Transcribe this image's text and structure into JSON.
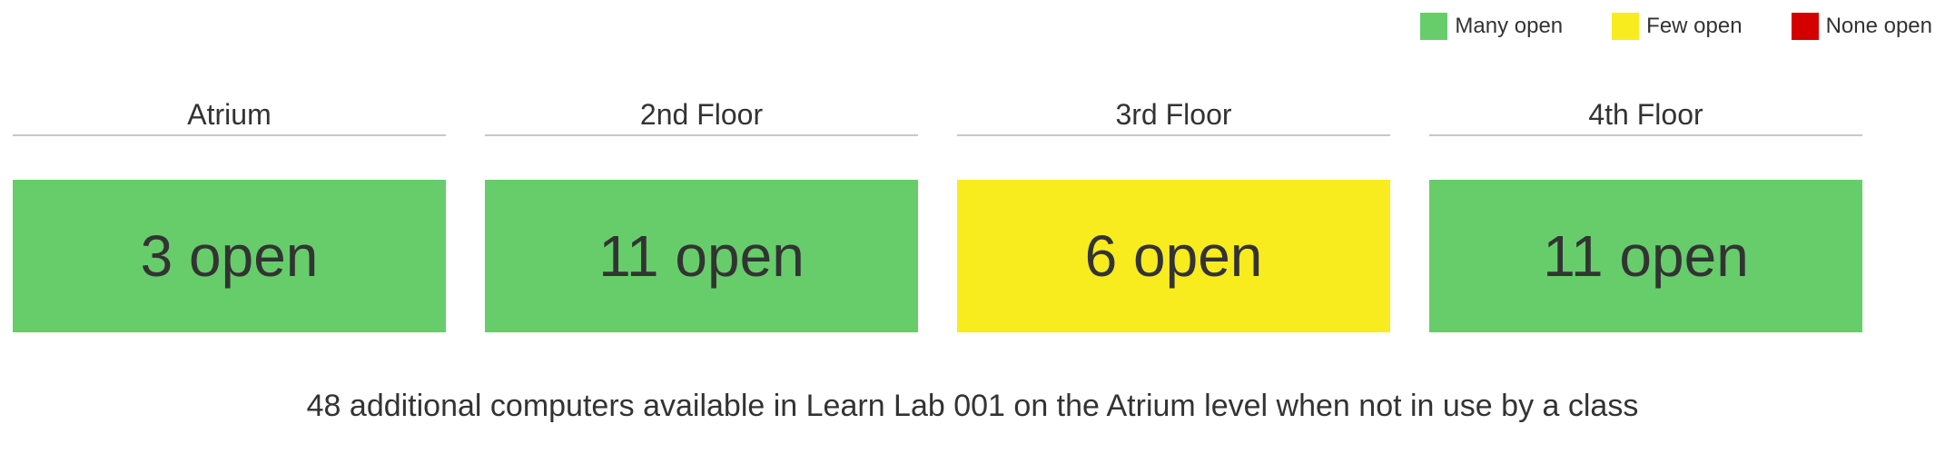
{
  "colors": {
    "many": "#66cd6a",
    "few": "#f8ec1e",
    "none": "#d40000"
  },
  "legend": {
    "items": [
      {
        "label": "Many open",
        "color": "#66cd6a"
      },
      {
        "label": "Few open",
        "color": "#f8ec1e"
      },
      {
        "label": "None open",
        "color": "#d40000"
      }
    ]
  },
  "floors": [
    {
      "name": "Atrium",
      "status": "3 open",
      "open_count": 3,
      "level": "many",
      "color": "#66cd6a"
    },
    {
      "name": "2nd Floor",
      "status": "11 open",
      "open_count": 11,
      "level": "many",
      "color": "#66cd6a"
    },
    {
      "name": "3rd Floor",
      "status": "6 open",
      "open_count": 6,
      "level": "few",
      "color": "#f8ec1e"
    },
    {
      "name": "4th Floor",
      "status": "11 open",
      "open_count": 11,
      "level": "many",
      "color": "#66cd6a"
    }
  ],
  "note": "48 additional computers available in Learn Lab 001 on the Atrium level when not in use by a class"
}
